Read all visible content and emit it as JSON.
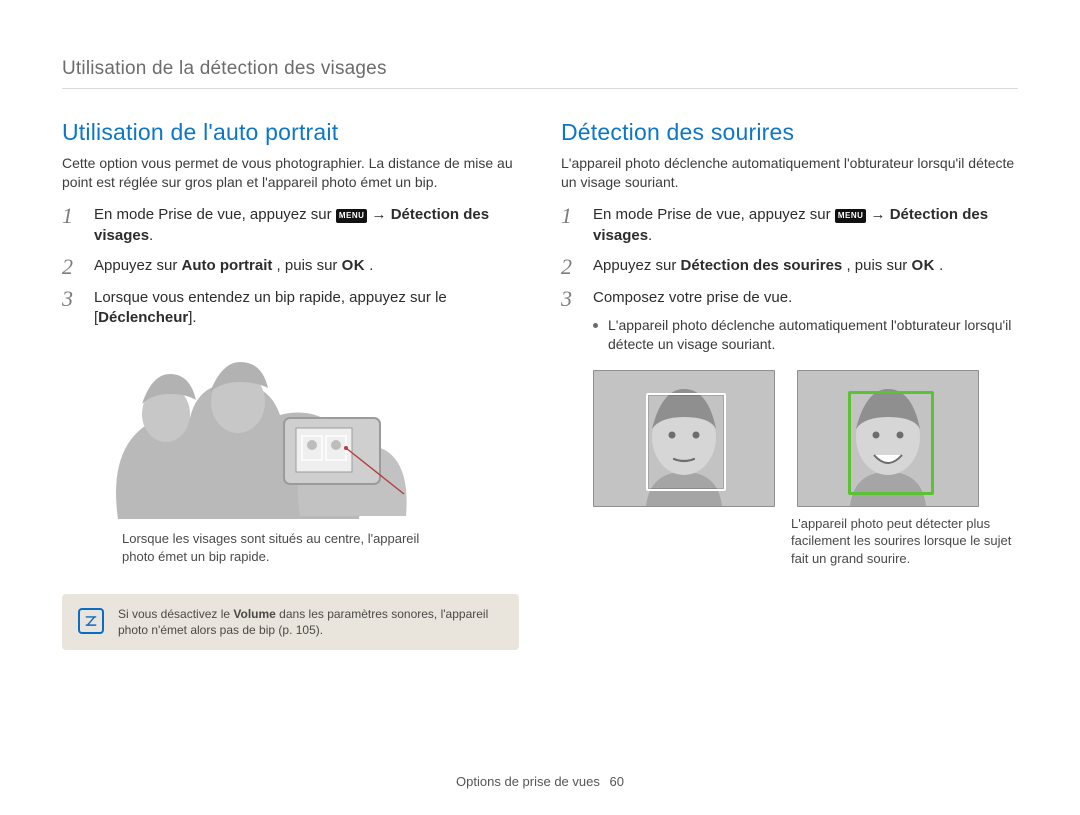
{
  "header": "Utilisation de la détection des visages",
  "left": {
    "title": "Utilisation de l'auto portrait",
    "intro": "Cette option vous permet de vous photographier. La distance de mise au point est réglée sur gros plan et l'appareil photo émet un bip.",
    "step1_pre": "En mode Prise de vue, appuyez sur ",
    "menu_chip": "MENU",
    "step1_arrow": " → ",
    "step1_bold": "Détection des visages",
    "step1_post": ".",
    "step2_pre": "Appuyez sur ",
    "step2_bold": "Auto portrait",
    "step2_mid": ", puis sur ",
    "ok_label": "OK",
    "step2_post": ".",
    "step3_pre": "Lorsque vous entendez un bip rapide, appuyez sur le [",
    "step3_bold": "Déclencheur",
    "step3_post": "].",
    "caption": "Lorsque les visages sont situés au centre, l'appareil photo émet un bip rapide.",
    "note_pre": "Si vous désactivez le ",
    "note_bold": "Volume",
    "note_post": " dans les paramètres sonores, l'appareil photo n'émet alors pas de bip (p. 105)."
  },
  "right": {
    "title": "Détection des sourires",
    "intro": "L'appareil photo déclenche automatiquement l'obturateur lorsqu'il détecte un visage souriant.",
    "step1_pre": "En mode Prise de vue, appuyez sur ",
    "menu_chip": "MENU",
    "step1_arrow": " → ",
    "step1_bold": "Détection des visages",
    "step1_post": ".",
    "step2_pre": "Appuyez sur ",
    "step2_bold": "Détection des sourires",
    "step2_mid": ", puis sur ",
    "ok_label": "OK",
    "step2_post": ".",
    "step3": "Composez votre prise de vue.",
    "bullet": "L'appareil photo déclenche automatiquement l'obturateur lorsqu'il détecte un visage souriant.",
    "caption": "L'appareil photo peut détecter plus facilement les sourires lorsque le sujet fait un grand sourire."
  },
  "footer": {
    "section": "Options de prise de vues",
    "page": "60"
  },
  "stepnums": {
    "n1": "1",
    "n2": "2",
    "n3": "3"
  }
}
